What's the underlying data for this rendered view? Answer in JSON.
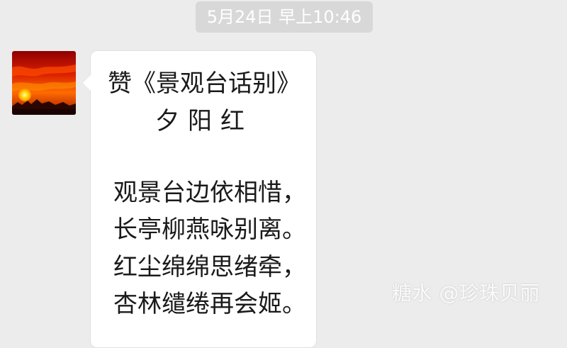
{
  "chat": {
    "timestamp": "5月24日 早上10:46"
  },
  "message": {
    "title": "赞《景观台话别》",
    "subtitle": "夕阳红",
    "lines": [
      "观景台边依相惜，",
      "长亭柳燕咏别离。",
      "红尘绵绵思绪牵，",
      "杏林缱绻再会姬。"
    ]
  },
  "avatar": {
    "image_name": "sunset-avatar-icon"
  },
  "watermark": {
    "text": "糖水 @珍珠贝丽"
  },
  "colors": {
    "background": "#ececec",
    "bubble": "#ffffff",
    "text": "#1a1a1a",
    "timestamp_bg": "#d8d8d8"
  }
}
